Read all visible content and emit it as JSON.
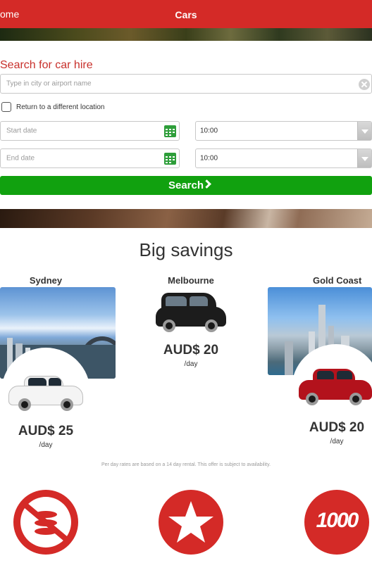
{
  "header": {
    "back_label": "ome",
    "title": "Cars"
  },
  "search": {
    "heading": "Search for car hire",
    "location_placeholder": "Type in city or airport name",
    "return_label": "Return to a different location",
    "start_placeholder": "Start date",
    "start_time": "10:00",
    "end_placeholder": "End date",
    "end_time": "10:00",
    "button_label": "Search"
  },
  "savings": {
    "title": "Big savings",
    "deals": [
      {
        "city": "Sydney",
        "price": "AUD$ 25",
        "unit": "/day",
        "car_color": "#f4f4f4"
      },
      {
        "city": "Melbourne",
        "price": "AUD$ 20",
        "unit": "/day",
        "car_color": "#1c1c1c"
      },
      {
        "city": "Gold Coast",
        "price": "AUD$ 20",
        "unit": "/day",
        "car_color": "#b3121c"
      }
    ],
    "disclaimer": "Per day rates are based on a 14 day rental. This offer is subject to availability."
  },
  "features": [
    {
      "icon": "no-fees-icon"
    },
    {
      "icon": "star-icon"
    },
    {
      "icon": "1000-icon",
      "text": "1000"
    }
  ],
  "colors": {
    "brand_red": "#d42a27",
    "search_green": "#11a10f"
  }
}
